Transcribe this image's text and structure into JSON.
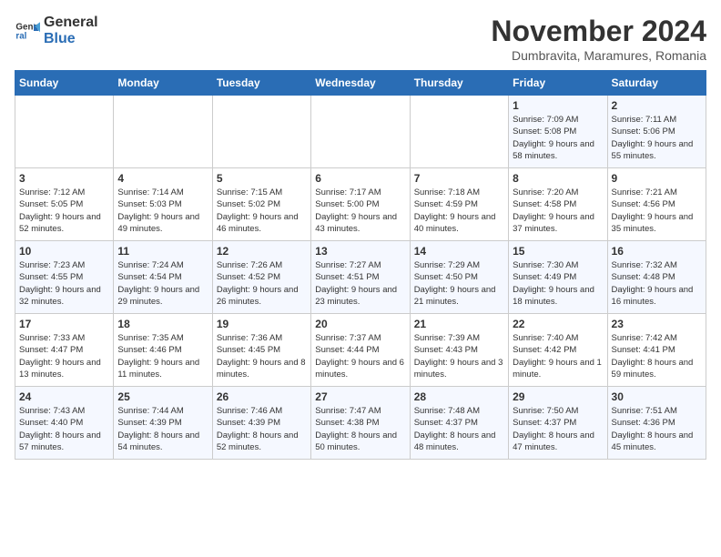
{
  "logo": {
    "line1": "General",
    "line2": "Blue"
  },
  "title": "November 2024",
  "location": "Dumbravita, Maramures, Romania",
  "weekdays": [
    "Sunday",
    "Monday",
    "Tuesday",
    "Wednesday",
    "Thursday",
    "Friday",
    "Saturday"
  ],
  "weeks": [
    [
      {
        "day": "",
        "info": ""
      },
      {
        "day": "",
        "info": ""
      },
      {
        "day": "",
        "info": ""
      },
      {
        "day": "",
        "info": ""
      },
      {
        "day": "",
        "info": ""
      },
      {
        "day": "1",
        "info": "Sunrise: 7:09 AM\nSunset: 5:08 PM\nDaylight: 9 hours and 58 minutes."
      },
      {
        "day": "2",
        "info": "Sunrise: 7:11 AM\nSunset: 5:06 PM\nDaylight: 9 hours and 55 minutes."
      }
    ],
    [
      {
        "day": "3",
        "info": "Sunrise: 7:12 AM\nSunset: 5:05 PM\nDaylight: 9 hours and 52 minutes."
      },
      {
        "day": "4",
        "info": "Sunrise: 7:14 AM\nSunset: 5:03 PM\nDaylight: 9 hours and 49 minutes."
      },
      {
        "day": "5",
        "info": "Sunrise: 7:15 AM\nSunset: 5:02 PM\nDaylight: 9 hours and 46 minutes."
      },
      {
        "day": "6",
        "info": "Sunrise: 7:17 AM\nSunset: 5:00 PM\nDaylight: 9 hours and 43 minutes."
      },
      {
        "day": "7",
        "info": "Sunrise: 7:18 AM\nSunset: 4:59 PM\nDaylight: 9 hours and 40 minutes."
      },
      {
        "day": "8",
        "info": "Sunrise: 7:20 AM\nSunset: 4:58 PM\nDaylight: 9 hours and 37 minutes."
      },
      {
        "day": "9",
        "info": "Sunrise: 7:21 AM\nSunset: 4:56 PM\nDaylight: 9 hours and 35 minutes."
      }
    ],
    [
      {
        "day": "10",
        "info": "Sunrise: 7:23 AM\nSunset: 4:55 PM\nDaylight: 9 hours and 32 minutes."
      },
      {
        "day": "11",
        "info": "Sunrise: 7:24 AM\nSunset: 4:54 PM\nDaylight: 9 hours and 29 minutes."
      },
      {
        "day": "12",
        "info": "Sunrise: 7:26 AM\nSunset: 4:52 PM\nDaylight: 9 hours and 26 minutes."
      },
      {
        "day": "13",
        "info": "Sunrise: 7:27 AM\nSunset: 4:51 PM\nDaylight: 9 hours and 23 minutes."
      },
      {
        "day": "14",
        "info": "Sunrise: 7:29 AM\nSunset: 4:50 PM\nDaylight: 9 hours and 21 minutes."
      },
      {
        "day": "15",
        "info": "Sunrise: 7:30 AM\nSunset: 4:49 PM\nDaylight: 9 hours and 18 minutes."
      },
      {
        "day": "16",
        "info": "Sunrise: 7:32 AM\nSunset: 4:48 PM\nDaylight: 9 hours and 16 minutes."
      }
    ],
    [
      {
        "day": "17",
        "info": "Sunrise: 7:33 AM\nSunset: 4:47 PM\nDaylight: 9 hours and 13 minutes."
      },
      {
        "day": "18",
        "info": "Sunrise: 7:35 AM\nSunset: 4:46 PM\nDaylight: 9 hours and 11 minutes."
      },
      {
        "day": "19",
        "info": "Sunrise: 7:36 AM\nSunset: 4:45 PM\nDaylight: 9 hours and 8 minutes."
      },
      {
        "day": "20",
        "info": "Sunrise: 7:37 AM\nSunset: 4:44 PM\nDaylight: 9 hours and 6 minutes."
      },
      {
        "day": "21",
        "info": "Sunrise: 7:39 AM\nSunset: 4:43 PM\nDaylight: 9 hours and 3 minutes."
      },
      {
        "day": "22",
        "info": "Sunrise: 7:40 AM\nSunset: 4:42 PM\nDaylight: 9 hours and 1 minute."
      },
      {
        "day": "23",
        "info": "Sunrise: 7:42 AM\nSunset: 4:41 PM\nDaylight: 8 hours and 59 minutes."
      }
    ],
    [
      {
        "day": "24",
        "info": "Sunrise: 7:43 AM\nSunset: 4:40 PM\nDaylight: 8 hours and 57 minutes."
      },
      {
        "day": "25",
        "info": "Sunrise: 7:44 AM\nSunset: 4:39 PM\nDaylight: 8 hours and 54 minutes."
      },
      {
        "day": "26",
        "info": "Sunrise: 7:46 AM\nSunset: 4:39 PM\nDaylight: 8 hours and 52 minutes."
      },
      {
        "day": "27",
        "info": "Sunrise: 7:47 AM\nSunset: 4:38 PM\nDaylight: 8 hours and 50 minutes."
      },
      {
        "day": "28",
        "info": "Sunrise: 7:48 AM\nSunset: 4:37 PM\nDaylight: 8 hours and 48 minutes."
      },
      {
        "day": "29",
        "info": "Sunrise: 7:50 AM\nSunset: 4:37 PM\nDaylight: 8 hours and 47 minutes."
      },
      {
        "day": "30",
        "info": "Sunrise: 7:51 AM\nSunset: 4:36 PM\nDaylight: 8 hours and 45 minutes."
      }
    ]
  ]
}
